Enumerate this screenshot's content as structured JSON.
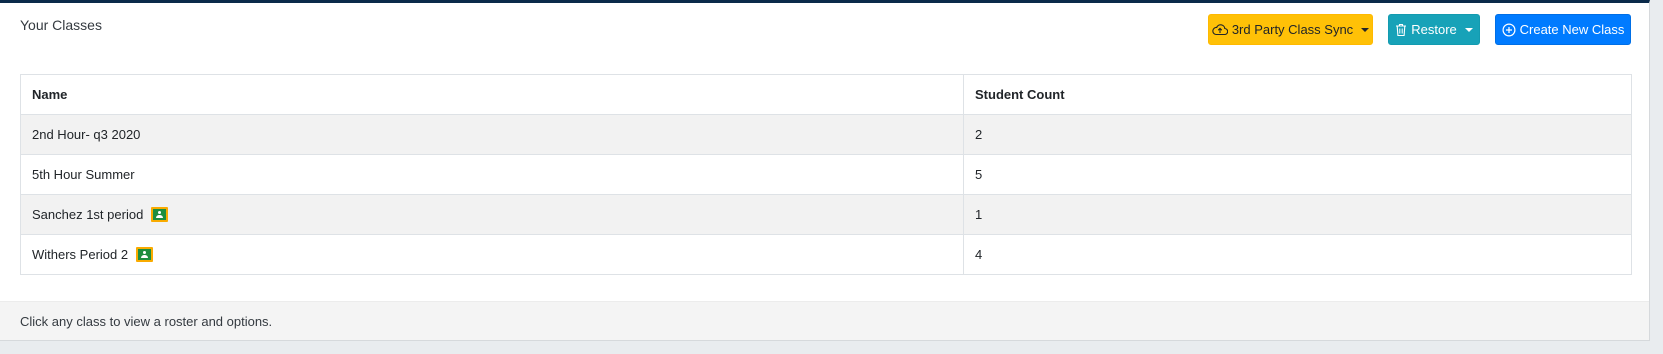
{
  "card": {
    "title": "Your Classes",
    "footer_text": "Click any class to view a roster and options."
  },
  "actions": {
    "sync": {
      "label": "3rd Party Class Sync",
      "icon": "cloud-upload-icon",
      "color": "#ffc107"
    },
    "restore": {
      "label": "Restore",
      "icon": "trash-icon",
      "color": "#17a2b8"
    },
    "create": {
      "label": "Create New Class",
      "icon": "plus-circle-icon",
      "color": "#007bff"
    }
  },
  "table": {
    "headers": {
      "name": "Name",
      "student_count": "Student Count"
    },
    "rows": [
      {
        "name": "2nd Hour- q3 2020",
        "student_count": "2",
        "google_classroom": false
      },
      {
        "name": "5th Hour Summer",
        "student_count": "5",
        "google_classroom": false
      },
      {
        "name": "Sanchez 1st period",
        "student_count": "1",
        "google_classroom": true
      },
      {
        "name": "Withers Period 2",
        "student_count": "4",
        "google_classroom": true
      }
    ]
  },
  "colors": {
    "top_border": "#0b2a4a",
    "row_stripe": "#f2f2f2"
  }
}
